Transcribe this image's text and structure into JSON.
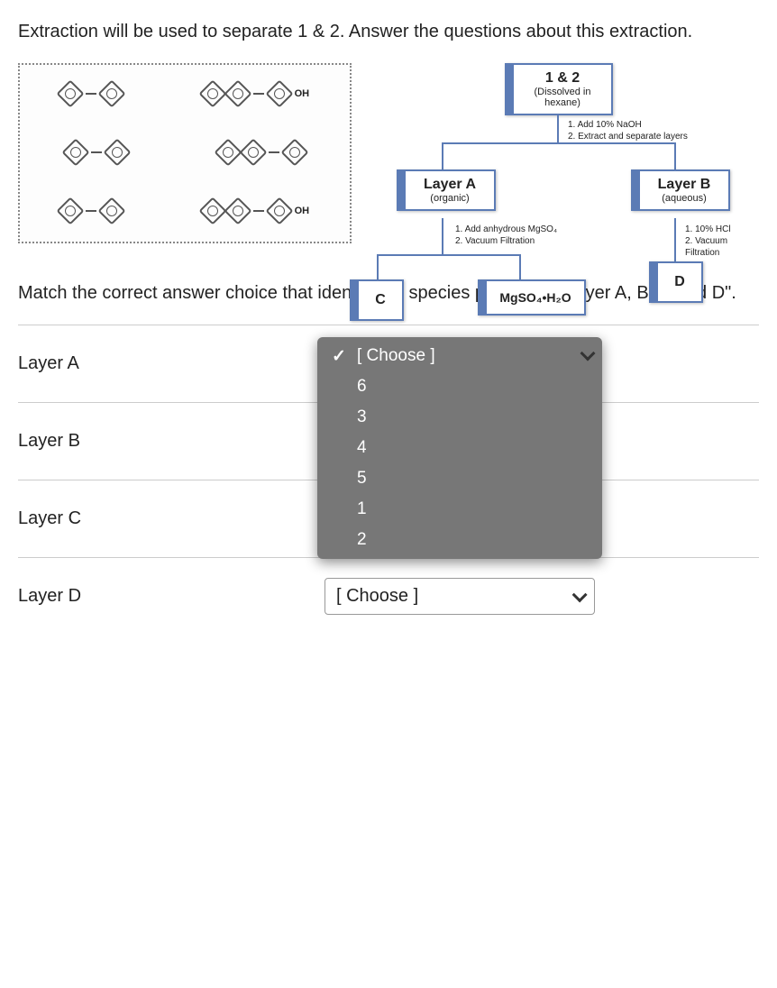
{
  "intro": "Extraction will be used to separate 1 & 2. Answer the questions about this extraction.",
  "molbox": {
    "labels": {
      "m1": "OH",
      "m2": "OH"
    }
  },
  "flow": {
    "top": {
      "title": "1 & 2",
      "sub": "(Dissolved in hexane)"
    },
    "step1": {
      "a": "1.   Add 10% NaOH",
      "b": "2.   Extract and separate layers"
    },
    "layerA": {
      "title": "Layer A",
      "sub": "(organic)"
    },
    "layerB": {
      "title": "Layer B",
      "sub": "(aqueous)"
    },
    "stepA": {
      "a": "1.   Add anhydrous MgSO₄",
      "b": "2.   Vacuum Filtration"
    },
    "stepB": {
      "a": "1.   10% HCl",
      "b": "2.   Vacuum Filtration"
    },
    "c": "C",
    "mg": "MgSO₄•H₂O",
    "d": "D"
  },
  "prompt2": "Match the correct answer choice that identifies a species present in \"Layer A, B, C and D\".",
  "rows": {
    "a": "Layer A",
    "b": "Layer B",
    "c": "Layer C",
    "d": "Layer D"
  },
  "placeholder": "[ Choose ]",
  "options": [
    "[ Choose ]",
    "6",
    "3",
    "4",
    "5",
    "1",
    "2"
  ]
}
